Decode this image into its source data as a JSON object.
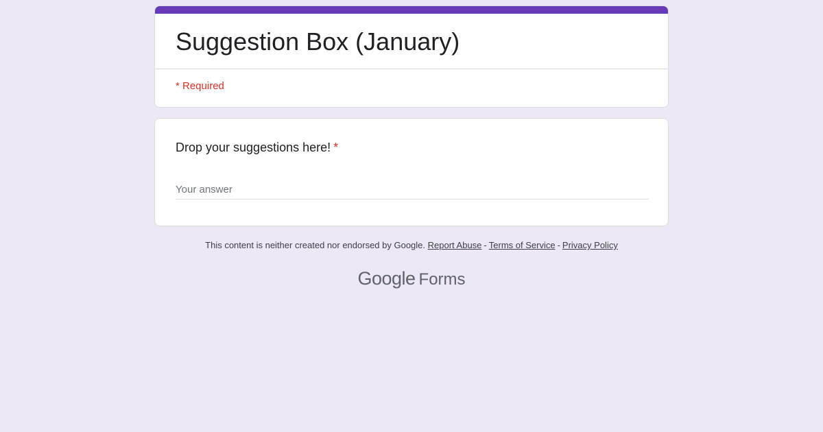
{
  "form": {
    "title": "Suggestion Box (January)",
    "required_note": "* Required",
    "accent_color": "#673ab7",
    "background_color": "#ede7f6"
  },
  "question": {
    "label": "Drop your suggestions here!",
    "required_marker": "*",
    "answer_placeholder": "Your answer",
    "answer_value": ""
  },
  "footer": {
    "disclaimer": "This content is neither created nor endorsed by Google.",
    "report_abuse": "Report Abuse",
    "separator_1": "-",
    "terms_of_service": "Terms of Service",
    "separator_2": "-",
    "privacy_policy": "Privacy Policy"
  },
  "brand": {
    "logo_word": "Google",
    "product": "Forms"
  }
}
